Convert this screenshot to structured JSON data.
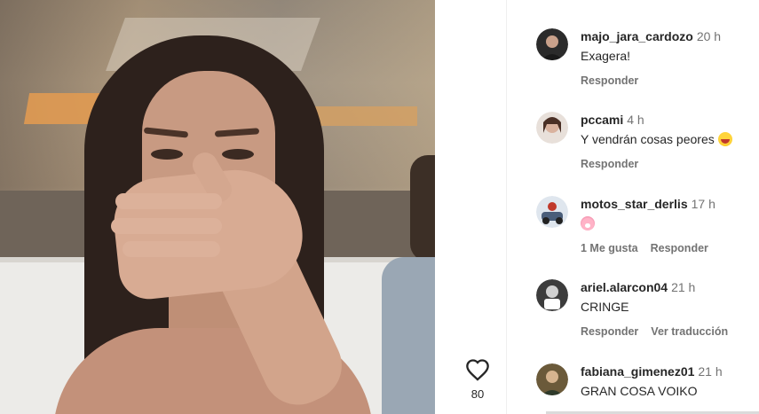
{
  "video": {
    "likes": "80",
    "like_icon": "heart-outline-icon"
  },
  "comments": [
    {
      "user": "majo_jara_cardozo",
      "time": "20 h",
      "text": "Exagera!",
      "emoji": "",
      "actions": [
        "Responder"
      ],
      "avatar_color": "#2b2b2b"
    },
    {
      "user": "pccami",
      "time": "4 h",
      "text": "Y vendrán cosas peores",
      "emoji": "laughing-emoji",
      "actions": [
        "Responder"
      ],
      "avatar_color": "#7a5a4e"
    },
    {
      "user": "motos_star_derlis",
      "time": "17 h",
      "text": "",
      "emoji": "pig-face-emoji",
      "actions": [
        "1 Me gusta",
        "Responder"
      ],
      "avatar_color": "#4a5e7a"
    },
    {
      "user": "ariel.alarcon04",
      "time": "21 h",
      "text": "CRINGE",
      "emoji": "",
      "actions": [
        "Responder",
        "Ver traducción"
      ],
      "avatar_color": "#3c3c3c"
    },
    {
      "user": "fabiana_gimenez01",
      "time": "21 h",
      "text": "GRAN COSA VOIKO",
      "emoji": "",
      "actions": [],
      "avatar_color": "#6b5a3a"
    }
  ]
}
